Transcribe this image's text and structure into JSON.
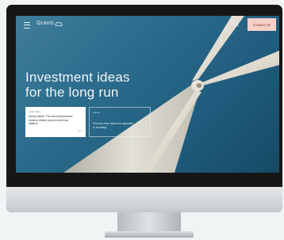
{
  "header": {
    "logo": "Gravis",
    "contact_label": "Contact Us"
  },
  "hero": {
    "title_line1": "Investment ideas",
    "title_line2": "for the long run"
  },
  "cards": [
    {
      "tag": "Gravis Blog",
      "text": "Money Week: The best infrastructure funds to shelter your income from inflation",
      "arrow": "→"
    },
    {
      "tag": "Funds",
      "text": "Find out more about our approach to investing",
      "arrow": "→"
    }
  ],
  "icons": {
    "menu": "menu-icon",
    "logo_mark": "cloud-icon",
    "search": "search-icon",
    "card_arrow": "arrow-right-icon"
  },
  "colors": {
    "sky": "#2c6c8c",
    "contact_button": "#f6cfc6",
    "card": "#ffffff"
  }
}
